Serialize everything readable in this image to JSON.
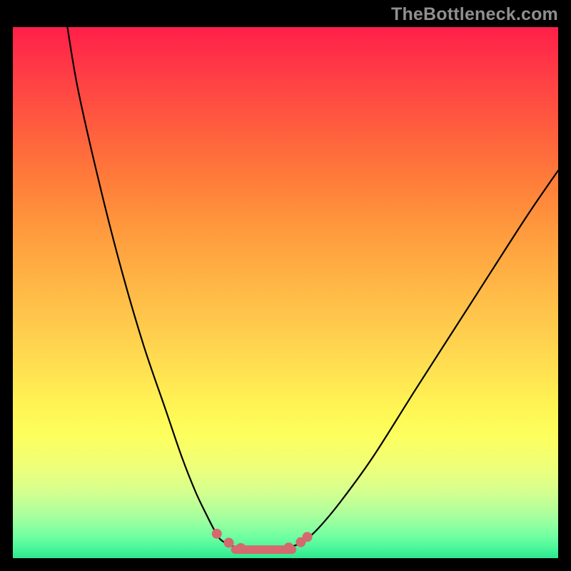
{
  "watermark": {
    "text": "TheBottleneck.com"
  },
  "colors": {
    "background": "#000000",
    "curve_stroke": "#000000",
    "marker_fill": "#d46a6e",
    "marker_stroke": "#c85c60",
    "gradient_stops": [
      "#ff1f49",
      "#ff3a46",
      "#ff5a3f",
      "#ff7a3a",
      "#ff993d",
      "#ffb545",
      "#ffcf4e",
      "#ffe552",
      "#fff654",
      "#fcff5e",
      "#f4ff70",
      "#e8ff7f",
      "#d8ff8c",
      "#c2ff96",
      "#a8ff9d",
      "#8cffa0",
      "#6effa1",
      "#4cf79a",
      "#2ee88f"
    ]
  },
  "chart_data": {
    "type": "line",
    "title": "",
    "xlabel": "",
    "ylabel": "",
    "xlim": [
      0,
      100
    ],
    "ylim": [
      0,
      100
    ],
    "grid": false,
    "legend": false,
    "_note": "Axes and units are not shown in the source image; x/y are normalized 0–100. y=0 corresponds to the bottom (green) edge, y=100 to the top (red).",
    "series": [
      {
        "name": "left_branch",
        "x": [
          10,
          12,
          16,
          20,
          24,
          28,
          31,
          33.5,
          35.5,
          37,
          38.2
        ],
        "y": [
          100,
          88,
          70,
          54,
          40,
          28,
          19,
          12.5,
          8.2,
          5.2,
          3.4
        ],
        "style": "curve"
      },
      {
        "name": "bottom_flat",
        "x": [
          38.2,
          40.5,
          43,
          46,
          49,
          51.5,
          53.5
        ],
        "y": [
          3.4,
          2.2,
          1.6,
          1.5,
          1.7,
          2.3,
          3.3
        ],
        "style": "curve"
      },
      {
        "name": "right_branch",
        "x": [
          53.5,
          56,
          60,
          66,
          74,
          84,
          94,
          100
        ],
        "y": [
          3.3,
          5.6,
          10.5,
          19,
          32,
          48,
          64,
          73
        ],
        "style": "curve"
      }
    ],
    "markers": [
      {
        "x": 37.4,
        "y": 4.6
      },
      {
        "x": 39.6,
        "y": 2.9
      },
      {
        "x": 41.8,
        "y": 1.9
      },
      {
        "x": 50.6,
        "y": 2.0
      },
      {
        "x": 52.8,
        "y": 3.0
      },
      {
        "x": 54.0,
        "y": 4.0
      }
    ],
    "bottom_band": {
      "x_start": 40.0,
      "x_end": 52.0,
      "thickness": 1.6
    }
  }
}
